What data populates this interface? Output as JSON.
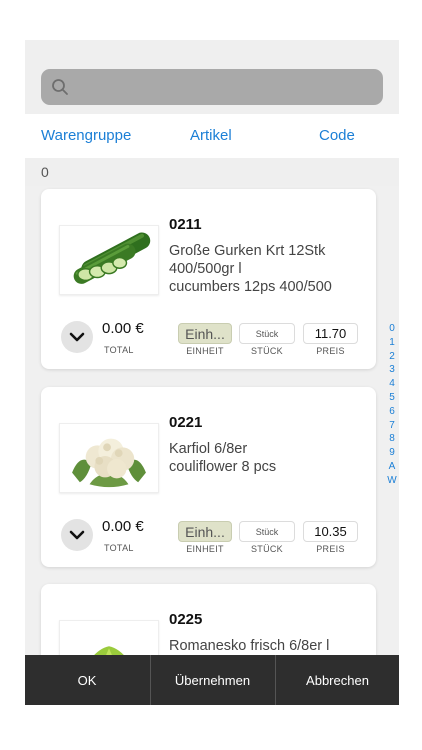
{
  "search": {
    "placeholder": ""
  },
  "tabs": [
    "Warengruppe",
    "Artikel",
    "Code"
  ],
  "group": {
    "label": "0"
  },
  "labels": {
    "total": "TOTAL",
    "einheit": "EINHEIT",
    "stueck": "STÜCK",
    "preis": "PREIS"
  },
  "products": [
    {
      "code": "0211",
      "name": "Große Gurken Krt 12Stk 400/500gr l",
      "name_en": "cucumbers 12ps 400/500",
      "total": "0.00 €",
      "einheit": "Einh...",
      "stueck": "Stück",
      "preis": "11.70",
      "image": "cucumber-image"
    },
    {
      "code": "0221",
      "name": "Karfiol 6/8er",
      "name_en": "couliflower 8 pcs",
      "total": "0.00 €",
      "einheit": "Einh...",
      "stueck": "Stück",
      "preis": "10.35",
      "image": "cauliflower-image"
    },
    {
      "code": "0225",
      "name": "Romanesko frisch 6/8er l",
      "name_en": "",
      "image": "romanesco-image"
    }
  ],
  "index": [
    "0",
    "1",
    "2",
    "3",
    "4",
    "5",
    "6",
    "7",
    "8",
    "9",
    "A",
    "W"
  ],
  "toolbar": {
    "ok": "OK",
    "apply": "Übernehmen",
    "cancel": "Abbrechen"
  },
  "colors": {
    "accent": "#1b7fd6",
    "toolbar": "#2e2e2e",
    "search": "#a9a9a9",
    "einheit_bg": "#dfe2c9"
  }
}
